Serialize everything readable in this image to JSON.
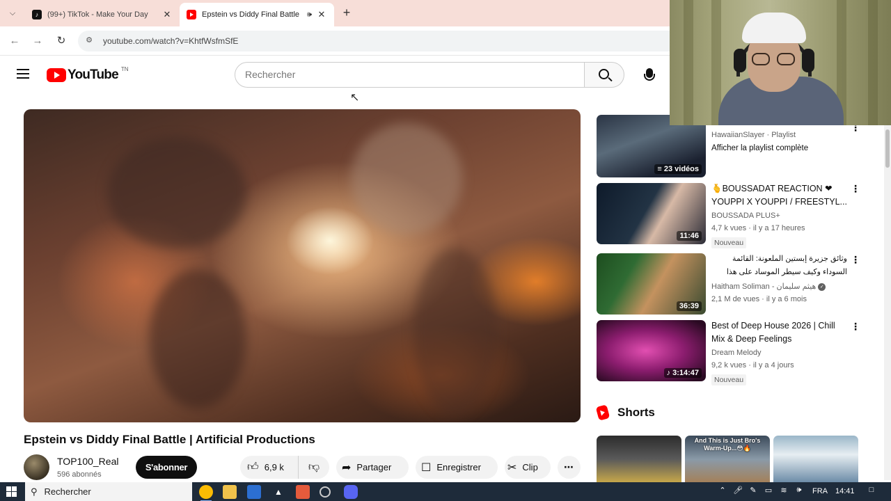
{
  "browser": {
    "tabs": [
      {
        "title": "(99+) TikTok - Make Your Day",
        "active": false
      },
      {
        "title": "Epstein vs Diddy Final Battle",
        "active": true
      }
    ],
    "url": "youtube.com/watch?v=KhtfWsfmSfE"
  },
  "youtube": {
    "logo_text": "YouTube",
    "logo_tm": "TN",
    "search_placeholder": "Rechercher",
    "video": {
      "title": "Epstein vs Diddy Final Battle | Artificial Productions",
      "channel": "TOP100_Real",
      "subscribers": "596 abonnés",
      "subscribe_label": "S'abonner",
      "likes": "6,9 k",
      "share_label": "Partager",
      "save_label": "Enregistrer",
      "clip_label": "Clip"
    },
    "sidebar": {
      "playlist": {
        "channel": "HawaiianSlayer · Playlist",
        "link": "Afficher la playlist complète",
        "count": "23 vidéos"
      },
      "items": [
        {
          "title": "🫰BOUSSADAT REACTION ❤ YOUPPI X YOUPPI / FREESTYL...",
          "channel": "BOUSSADA PLUS+",
          "meta": "4,7 k vues · il y a 17 heures",
          "badge": "Nouveau",
          "duration": "11:46",
          "verified": false
        },
        {
          "title": "وثائق جزيرة إبستين الملعونة: القائمة السوداء وكيف سيطر الموساد على هذا العالم؟",
          "channel": "Haitham Soliman - هيثم سليمان",
          "meta": "2,1 M de vues · il y a 6 mois",
          "badge": "",
          "duration": "36:39",
          "verified": true
        },
        {
          "title": "Best of Deep House 2026 | Chill Mix & Deep Feelings",
          "channel": "Dream Melody",
          "meta": "9,2 k vues · il y a 4 jours",
          "badge": "Nouveau",
          "duration": "3:14:47",
          "verified": false
        }
      ],
      "shorts_title": "Shorts",
      "shorts": [
        {
          "caption": ""
        },
        {
          "caption": "And This is Just Bro's Warm-Up...😳🔥"
        },
        {
          "caption": ""
        }
      ]
    }
  },
  "taskbar": {
    "search_placeholder": "Rechercher",
    "language": "FRA",
    "time": "14:41"
  }
}
